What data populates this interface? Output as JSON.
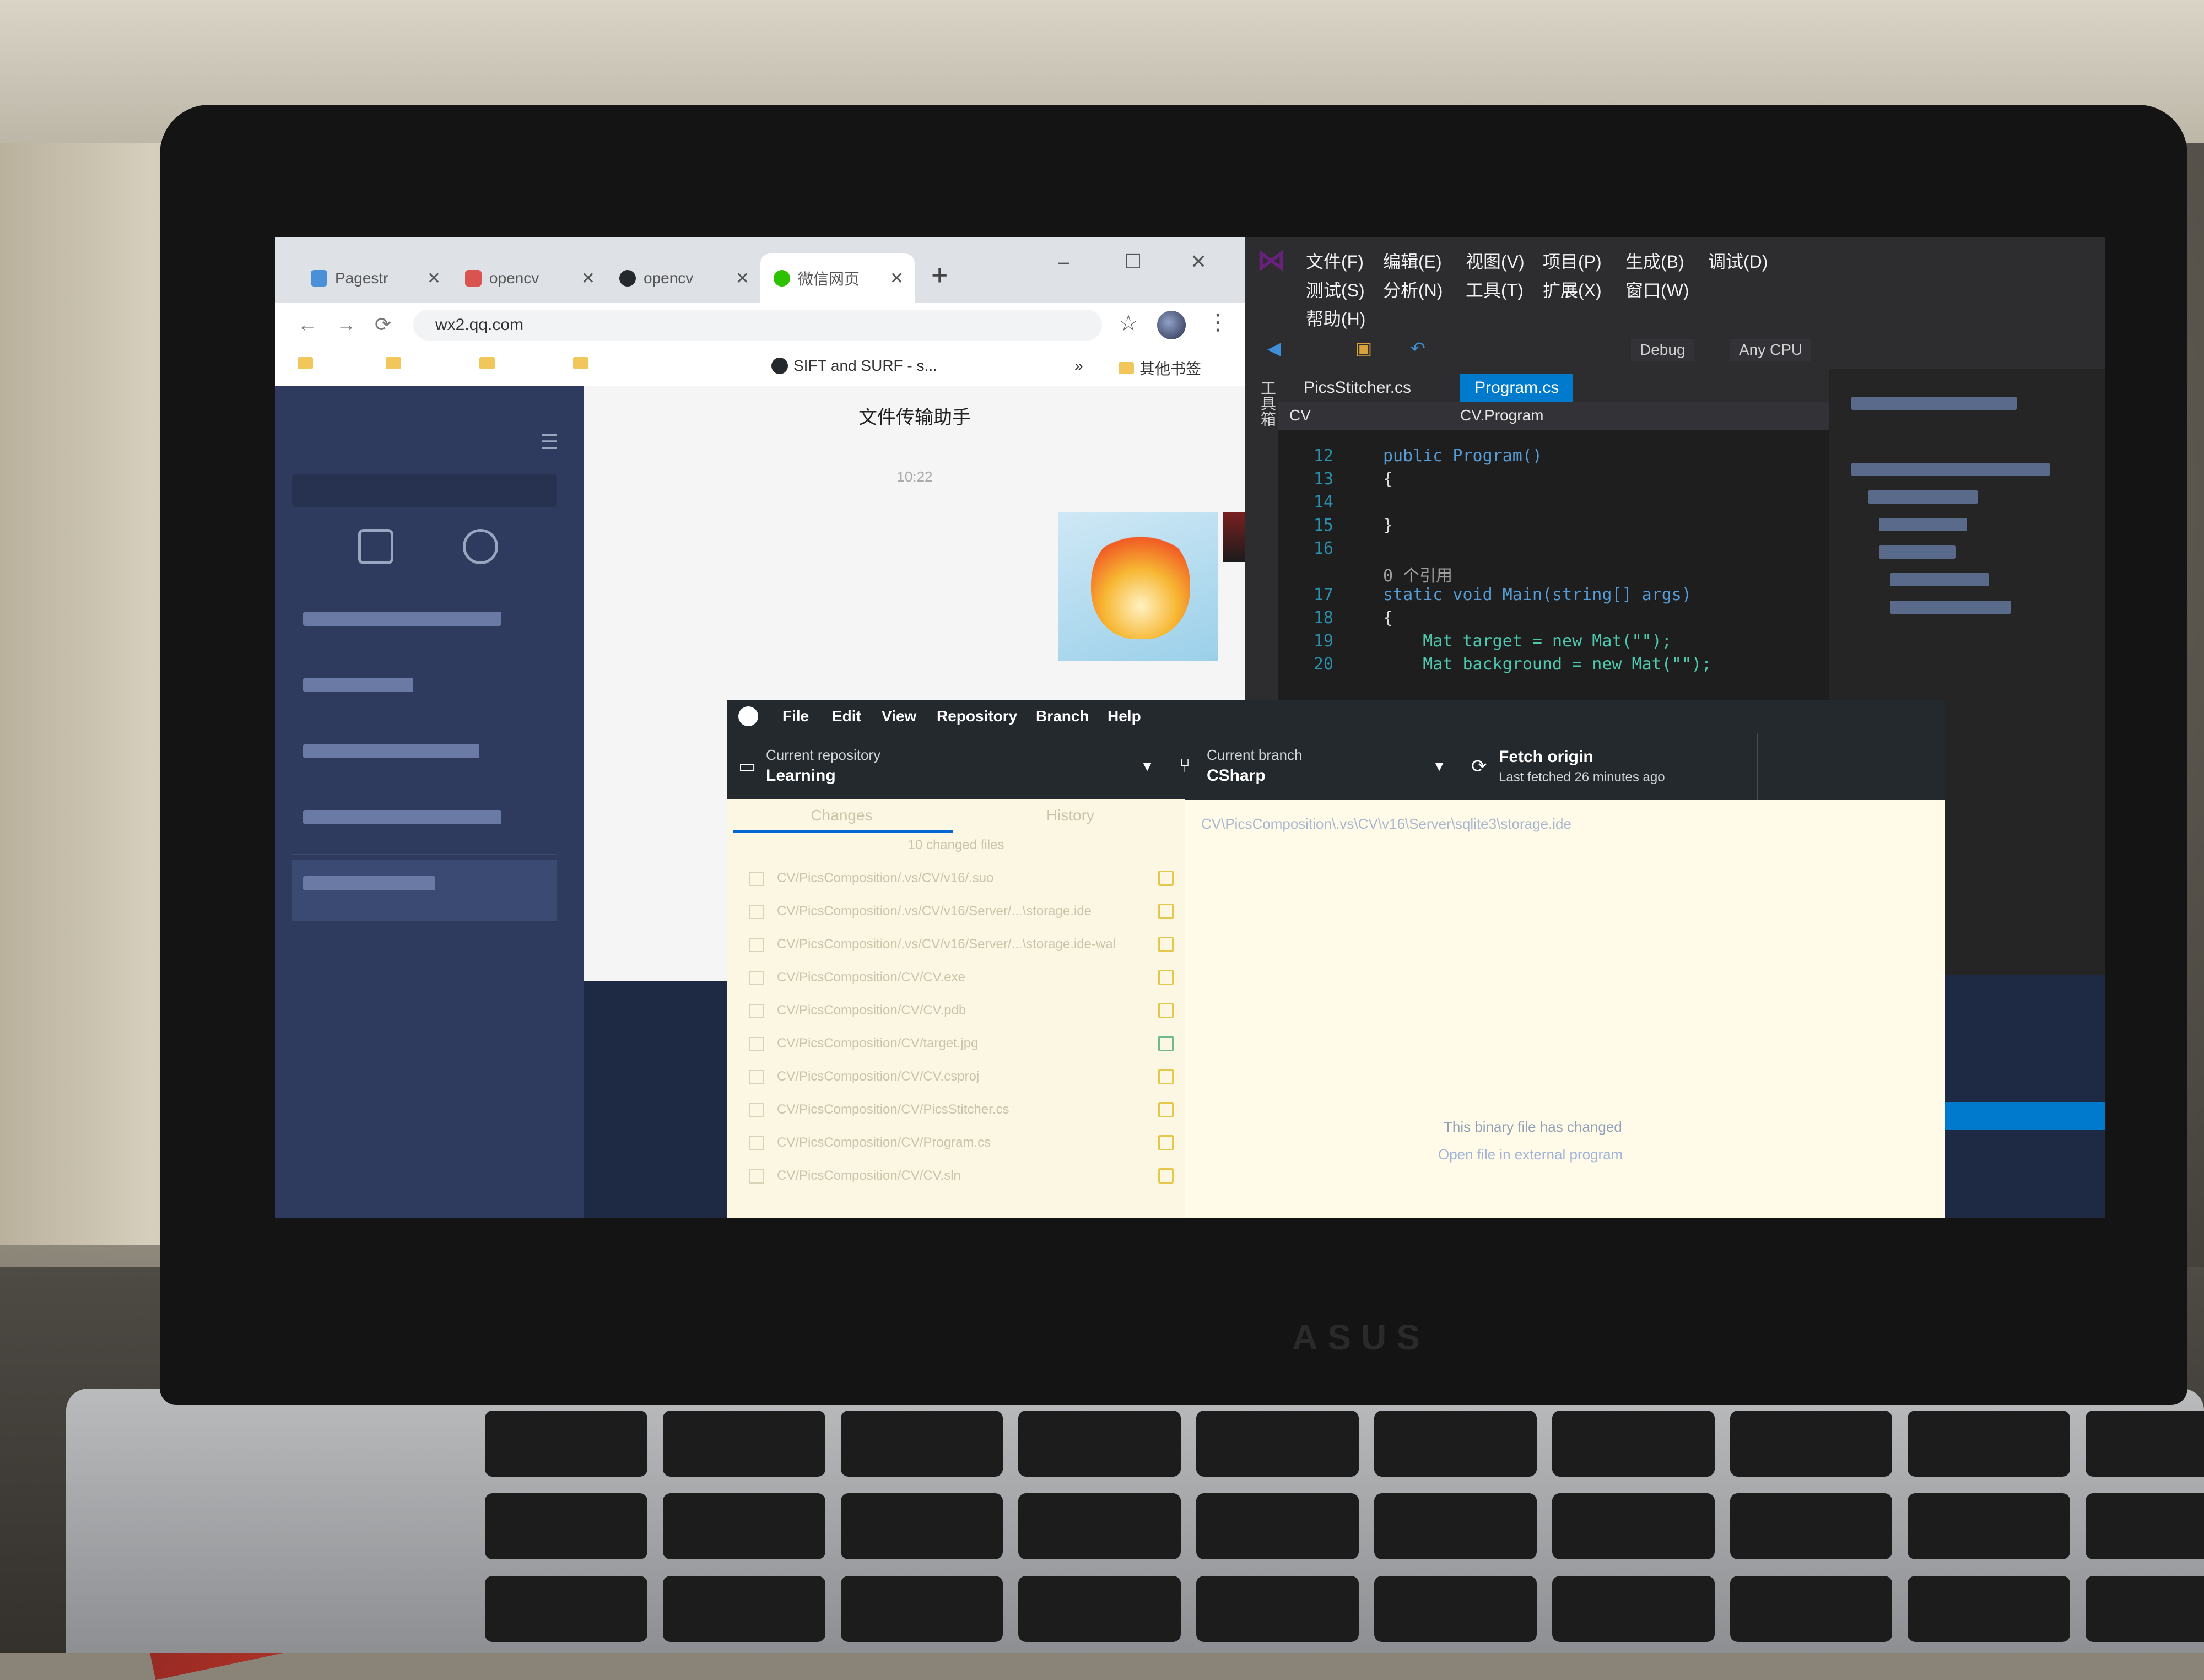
{
  "chrome": {
    "tabs": [
      {
        "label": "Pagestr",
        "active": false
      },
      {
        "label": "opencv",
        "active": false
      },
      {
        "label": "opencv",
        "active": false
      },
      {
        "label": "微信网页",
        "active": true
      }
    ],
    "new_tab": "+",
    "address": "wx2.qq.com",
    "bookmarks": [
      "SIFT and SURF - s..."
    ],
    "bookmarks_more": "»",
    "other_bookmarks": "其他书签",
    "window_controls": {
      "minimize": "–",
      "maximize": "☐",
      "close": "✕"
    }
  },
  "wechat": {
    "chat_title": "文件传输助手",
    "timestamp": "10:22"
  },
  "visual_studio": {
    "menu": [
      "文件(F)",
      "编辑(E)",
      "视图(V)",
      "项目(P)",
      "生成(B)",
      "调试(D)",
      "测试(S)",
      "分析(N)",
      "工具(T)",
      "扩展(X)",
      "窗口(W)",
      "帮助(H)"
    ],
    "config": "Debug",
    "platform": "Any CPU",
    "sidebar_label": "工具箱",
    "doc_tabs": [
      "PicsStitcher.cs",
      "Program.cs"
    ],
    "nav_project": "CV",
    "nav_class": "CV.Program",
    "code_lines": [
      {
        "n": "12",
        "code": "public Program()",
        "cls": "kw"
      },
      {
        "n": "13",
        "code": "{",
        "cls": "tx"
      },
      {
        "n": "14",
        "code": "",
        "cls": "tx"
      },
      {
        "n": "15",
        "code": "}",
        "cls": "tx"
      },
      {
        "n": "16",
        "code": "",
        "cls": "tx"
      },
      {
        "n": "",
        "code": "0 个引用",
        "cls": "cm"
      },
      {
        "n": "17",
        "code": "static void Main(string[] args)",
        "cls": "kw"
      },
      {
        "n": "18",
        "code": "{",
        "cls": "tx"
      },
      {
        "n": "19",
        "code": "    Mat target = new Mat(\"\");",
        "cls": "ty"
      },
      {
        "n": "20",
        "code": "    Mat background = new Mat(\"\");",
        "cls": "ty"
      }
    ]
  },
  "github_desktop": {
    "menu": [
      "File",
      "Edit",
      "View",
      "Repository",
      "Branch",
      "Help"
    ],
    "repo_label": "Current repository",
    "repo_name": "Learning",
    "branch_label": "Current branch",
    "branch_name": "CSharp",
    "fetch_label": "Fetch origin",
    "fetch_sub": "Last fetched 26 minutes ago",
    "tabs": [
      "Changes",
      "History"
    ],
    "changed_count": "10 changed files",
    "files": [
      {
        "name": "CV/PicsComposition/.vs/CV/v16/.suo",
        "status": "modified"
      },
      {
        "name": "CV/PicsComposition/.vs/CV/v16/Server/...\\storage.ide",
        "status": "modified"
      },
      {
        "name": "CV/PicsComposition/.vs/CV/v16/Server/...\\storage.ide-wal",
        "status": "modified"
      },
      {
        "name": "CV/PicsComposition/CV/CV.exe",
        "status": "modified"
      },
      {
        "name": "CV/PicsComposition/CV/CV.pdb",
        "status": "modified"
      },
      {
        "name": "CV/PicsComposition/CV/target.jpg",
        "status": "added"
      },
      {
        "name": "CV/PicsComposition/CV/CV.csproj",
        "status": "modified"
      },
      {
        "name": "CV/PicsComposition/CV/PicsStitcher.cs",
        "status": "modified"
      },
      {
        "name": "CV/PicsComposition/CV/Program.cs",
        "status": "modified"
      },
      {
        "name": "CV/PicsComposition/CV/CV.sln",
        "status": "modified"
      }
    ],
    "selected_path": "CV\\PicsComposition\\.vs\\CV\\v16\\Server\\sqlite3\\storage.ide",
    "binary_message": "This binary file has changed",
    "binary_link": "Open file in external program"
  },
  "laptop": {
    "brand": "ASUS"
  },
  "colors": {
    "vs_accent": "#007acc",
    "ghd_header": "#24292e",
    "wechat_sidebar": "#2e3b5e",
    "ghd_body": "#fffbe8"
  }
}
